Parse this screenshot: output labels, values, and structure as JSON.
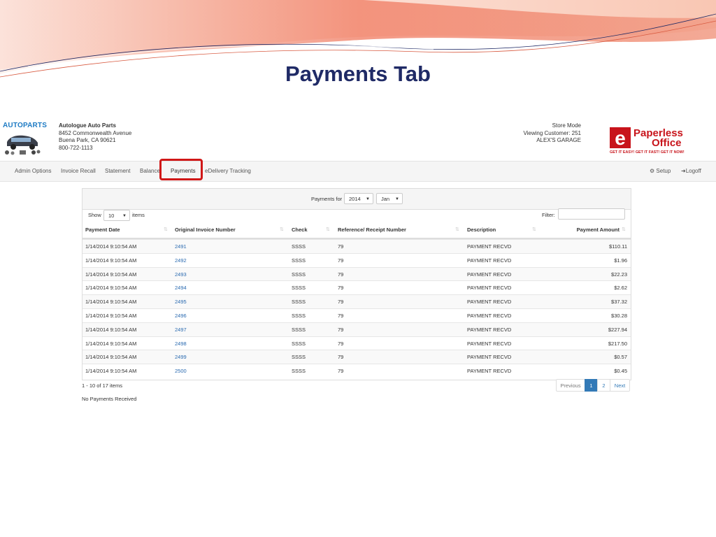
{
  "slide": {
    "title": "Payments Tab"
  },
  "header": {
    "logo_text": "AUTOPARTS",
    "store": {
      "name": "Autologue Auto Parts",
      "address1": "8452 Commonwealth Avenue",
      "address2": "Buena Park, CA 90621",
      "phone": "800-722-1113"
    },
    "customer": {
      "mode": "Store Mode",
      "viewing": "Viewing Customer: 251",
      "name": "ALEX'S GARAGE"
    },
    "brand_logo": {
      "letter": "e",
      "word1": "Paperless",
      "word2": "Office",
      "tagline": "GET IT EASY! GET IT FAST! GET IT NOW!"
    }
  },
  "nav": {
    "items": [
      "Admin Options",
      "Invoice Recall",
      "Statement",
      "Balance",
      "Payments",
      "eDelivery Tracking"
    ],
    "active": "Payments",
    "setup_label": "Setup",
    "logoff_label": "Logoff"
  },
  "panel": {
    "payments_for_label": "Payments for",
    "year_value": "2014",
    "month_value": "Jan",
    "show_label": "Show",
    "page_size": "10",
    "items_label": "items",
    "filter_label": "Filter:"
  },
  "table": {
    "columns": [
      "Payment Date",
      "Original Invoice Number",
      "Check",
      "Reference/ Receipt Number",
      "Description",
      "Payment Amount"
    ],
    "rows": [
      [
        "1/14/2014 9:10:54 AM",
        "2491",
        "SSSS",
        "79",
        "PAYMENT RECVD",
        "$110.11"
      ],
      [
        "1/14/2014 9:10:54 AM",
        "2492",
        "SSSS",
        "79",
        "PAYMENT RECVD",
        "$1.96"
      ],
      [
        "1/14/2014 9:10:54 AM",
        "2493",
        "SSSS",
        "79",
        "PAYMENT RECVD",
        "$22.23"
      ],
      [
        "1/14/2014 9:10:54 AM",
        "2494",
        "SSSS",
        "79",
        "PAYMENT RECVD",
        "$2.62"
      ],
      [
        "1/14/2014 9:10:54 AM",
        "2495",
        "SSSS",
        "79",
        "PAYMENT RECVD",
        "$37.32"
      ],
      [
        "1/14/2014 9:10:54 AM",
        "2496",
        "SSSS",
        "79",
        "PAYMENT RECVD",
        "$30.28"
      ],
      [
        "1/14/2014 9:10:54 AM",
        "2497",
        "SSSS",
        "79",
        "PAYMENT RECVD",
        "$227.94"
      ],
      [
        "1/14/2014 9:10:54 AM",
        "2498",
        "SSSS",
        "79",
        "PAYMENT RECVD",
        "$217.50"
      ],
      [
        "1/14/2014 9:10:54 AM",
        "2499",
        "SSSS",
        "79",
        "PAYMENT RECVD",
        "$0.57"
      ],
      [
        "1/14/2014 9:10:54 AM",
        "2500",
        "SSSS",
        "79",
        "PAYMENT RECVD",
        "$0.45"
      ]
    ]
  },
  "footer": {
    "range_info": "1 - 10 of 17 items",
    "no_payments": "No Payments Received",
    "pagination": {
      "previous": "Previous",
      "pages": [
        "1",
        "2"
      ],
      "current": "1",
      "next": "Next"
    }
  },
  "colors": {
    "title": "#1f2a66",
    "link": "#2a6ab0",
    "active_page": "#337ab7",
    "highlight": "#d01818",
    "swoosh": "#e8826a"
  }
}
